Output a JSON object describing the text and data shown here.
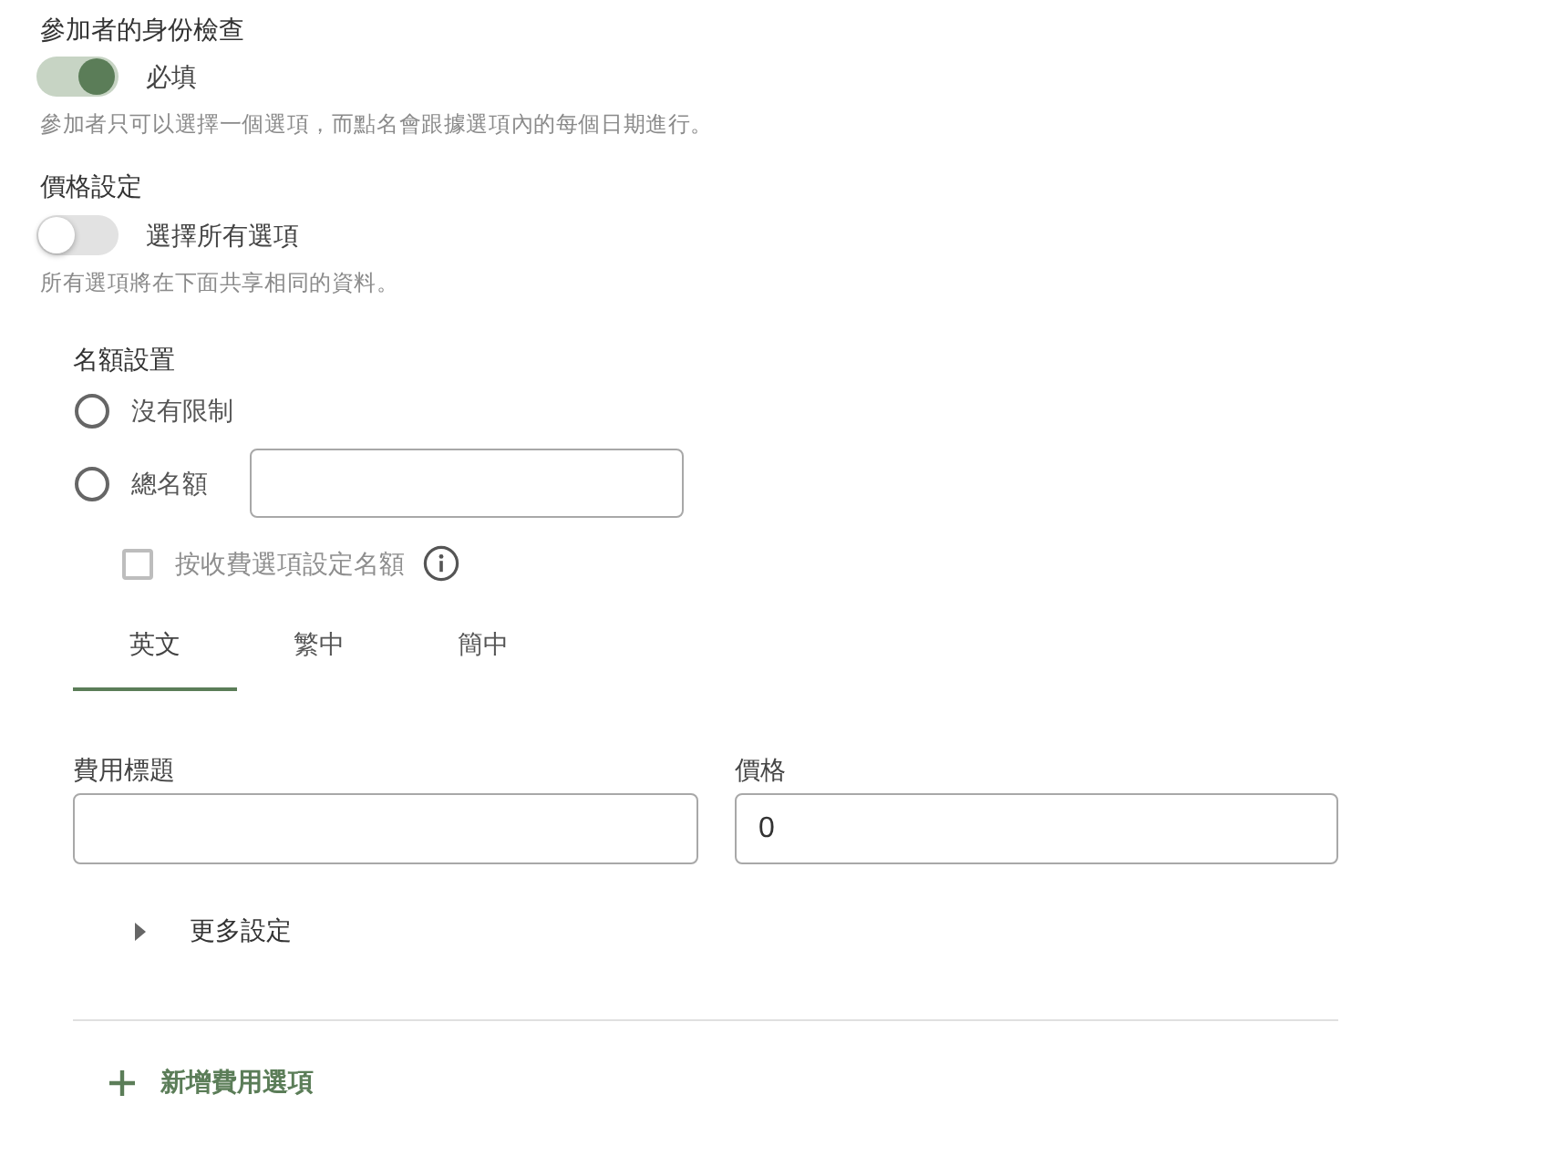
{
  "identity_check": {
    "title": "參加者的身份檢查",
    "toggle": {
      "label": "必填",
      "on": true
    },
    "hint": "參加者只可以選擇一個選項，而點名會跟據選項內的每個日期進行。"
  },
  "price_settings": {
    "title": "價格設定",
    "toggle": {
      "label": "選擇所有選項",
      "on": false
    },
    "hint": "所有選項將在下面共享相同的資料。"
  },
  "quota": {
    "title": "名額設置",
    "options": [
      {
        "label": "沒有限制",
        "selected": false,
        "kind": "plain"
      },
      {
        "label": "總名額",
        "selected": false,
        "kind": "with_input"
      }
    ],
    "per_option": {
      "label": "按收費選項設定名額",
      "checked": false,
      "disabled": true
    }
  },
  "tabs": [
    {
      "label": "英文",
      "selected": true
    },
    {
      "label": "繁中",
      "selected": false
    },
    {
      "label": "簡中",
      "selected": false
    }
  ],
  "fee_fields": [
    {
      "label": "費用標題"
    },
    {
      "label": "價格",
      "value": "0"
    }
  ],
  "more_settings": {
    "label": "更多設定",
    "expanded": false
  },
  "add_button": {
    "label": "新增費用選項"
  }
}
